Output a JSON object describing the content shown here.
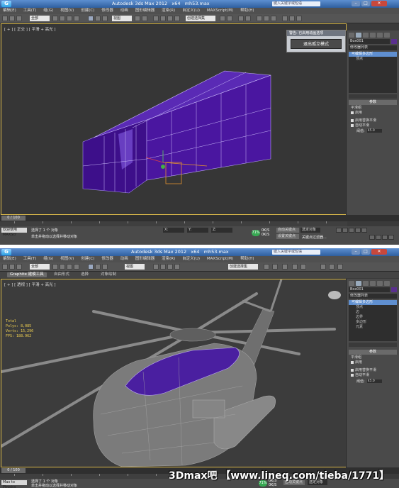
{
  "top": {
    "title": "Autodesk 3ds Max 2012   x64   mh53.max",
    "search_placeholder": "键入关键字或短语",
    "menu": [
      "编辑(E)",
      "工具(T)",
      "组(G)",
      "视图(V)",
      "创建(C)",
      "修改器",
      "动画",
      "图形编辑器",
      "渲染(R)",
      "自定义(U)",
      "MAXScript(M)",
      "帮助(H)"
    ],
    "toolbar": {
      "selection_filter": "全部",
      "ref_coord": "视图",
      "named_sel": "创建选择集"
    },
    "viewport_label": "[ + ] [ 正交 ] [ 平滑 + 高光 ]",
    "dialog": {
      "title": "警告: 已启用动画选项",
      "button": "退出孤立模式"
    },
    "cmd": {
      "name": "Box001",
      "modifier_list": "修改器列表",
      "stack": [
        "可编辑多边形",
        "顶点"
      ],
      "params_header": "参数",
      "param_lines": [
        "平滑组",
        "启用",
        "自动平滑",
        "阈值: 45.0"
      ],
      "checks": [
        "启用替换平滑",
        "自动平滑"
      ],
      "threshold_label": "阈值:",
      "threshold_value": "45.0"
    },
    "time": {
      "frame": "0 / 100"
    },
    "status": {
      "line1": "选择了 1 个 对象",
      "line2": "单击并拖动以选择并移动对象",
      "prompt": "欢迎使用 MAXScr",
      "x": "X: ",
      "y": "Y: ",
      "z": "Z: ",
      "grid": "栅格 = 10.0",
      "autokey": "自动关键点",
      "selected": "选定对象",
      "setkey": "设置关键点",
      "keyfilter": "关键点过滤器...",
      "badge": "71%",
      "speed_up": "0K/S",
      "speed_down": "0K/S"
    }
  },
  "bottom": {
    "title": "Autodesk 3ds Max 2012   x64   mh53.max",
    "search_placeholder": "键入关键字或短语",
    "menu": [
      "编辑(E)",
      "工具(T)",
      "组(G)",
      "视图(V)",
      "创建(C)",
      "修改器",
      "动画",
      "图形编辑器",
      "渲染(R)",
      "自定义(U)",
      "MAXScript(M)",
      "帮助(H)"
    ],
    "toolbar": {
      "selection_filter": "全部",
      "ref_coord": "视图",
      "named_sel": "创建选择集"
    },
    "ribbon": [
      "Graphite 建模工具",
      "自由形式",
      "选择",
      "对象绘制"
    ],
    "viewport_label": "[ + ] [ 透视 ] [ 平滑 + 高光 ]",
    "stats": [
      "Total",
      "Polys: 8,085",
      "Verts: 15,296",
      "",
      "FPS: 188.962"
    ],
    "cmd": {
      "name": "Box001",
      "modifier_list": "修改器列表",
      "stack": [
        "可编辑多边形",
        "顶点",
        "边",
        "边界",
        "多边形",
        "元素"
      ],
      "params_header": "参数",
      "param_lines": [
        "平滑组",
        "启用"
      ],
      "checks": [
        "启用替换平滑",
        "自动平滑"
      ],
      "threshold_label": "阈值:",
      "threshold_value": "45.0"
    },
    "time": {
      "frame": "0 / 100"
    },
    "status": {
      "line1": "选择了 1 个 对象",
      "line2": "单击并拖动以选择并移动对象",
      "prompt": "Max to Physics",
      "badge": "71%",
      "speed_up": "0K/S",
      "speed_down": "0K/S",
      "autokey": "自动关键点",
      "selected": "选定对象"
    }
  },
  "watermark": "3Dmax吧 【www.lineq.com/tieba/1771】",
  "colors": {
    "accent": "#d9b84a",
    "selection": "#5a2f8f",
    "title_bar": "#3a6fb5"
  }
}
